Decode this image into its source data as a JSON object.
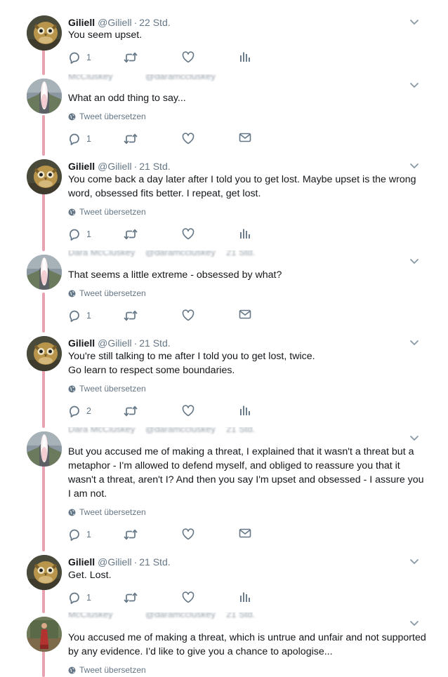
{
  "tweets": [
    {
      "author": "Giliell",
      "handle": "@Giliell",
      "time": "22 Std.",
      "text": [
        "You seem upset."
      ],
      "replies": "1",
      "translate": "",
      "action4": "analytics-icon",
      "avatar": "owl"
    },
    {
      "author": "",
      "handle": "",
      "time": "",
      "text": [
        "What an odd thing to say..."
      ],
      "replies": "1",
      "translate": "Tweet übersetzen",
      "action4": "dm-icon",
      "avatar": "road"
    },
    {
      "author": "Giliell",
      "handle": "@Giliell",
      "time": "21 Std.",
      "text": [
        "You come back a day later after I told you to get lost. Maybe upset is the wrong",
        "word, obsessed fits better. I repeat, get lost."
      ],
      "replies": "1",
      "translate": "Tweet übersetzen",
      "action4": "analytics-icon",
      "avatar": "owl"
    },
    {
      "author": "",
      "handle": "",
      "time": "",
      "text": [
        "That seems a little extreme - obsessed by what?"
      ],
      "replies": "1",
      "translate": "Tweet übersetzen",
      "action4": "dm-icon",
      "avatar": "road"
    },
    {
      "author": "Giliell",
      "handle": "@Giliell",
      "time": "21 Std.",
      "text": [
        "You're still talking to me after I told you to get lost, twice.",
        "Go learn to respect some boundaries."
      ],
      "replies": "2",
      "translate": "Tweet übersetzen",
      "action4": "analytics-icon",
      "avatar": "owl"
    },
    {
      "author": "",
      "handle": "",
      "time": "",
      "text": [
        "But you accused me of making a threat, I explained that it wasn't a threat but a",
        "metaphor - I'm allowed to defend myself, and obliged to reassure you that it",
        "wasn't a threat, aren't I? And then you say I'm upset and obsessed - I assure you",
        "I am not."
      ],
      "replies": "1",
      "translate": "Tweet übersetzen",
      "action4": "dm-icon",
      "avatar": "road"
    },
    {
      "author": "Giliell",
      "handle": "@Giliell",
      "time": "21 Std.",
      "text": [
        "Get. Lost."
      ],
      "replies": "1",
      "translate": "",
      "action4": "analytics-icon",
      "avatar": "owl"
    },
    {
      "author": "",
      "handle": "",
      "time": "",
      "text": [
        "You accused me of making a threat, which is untrue and unfair and not supported",
        "by any evidence. I'd like to give you a chance to apologise..."
      ],
      "replies": "",
      "translate": "Tweet übersetzen",
      "action4": "",
      "avatar": "person"
    }
  ],
  "blurred_headers": [
    [
      "McCluskey",
      "@daramccluskey"
    ],
    [
      "Dara McCluskey",
      "@daramccluskey",
      "21 Std."
    ],
    [
      "Dara McCluskey",
      "@daramccluskey",
      "21 Std."
    ],
    [
      "McCluskey",
      "@daramccluskey",
      "21 Std."
    ]
  ],
  "colors": {
    "thread_line": "#e8a3b3",
    "icon": "#657786",
    "text": "#14171a"
  }
}
